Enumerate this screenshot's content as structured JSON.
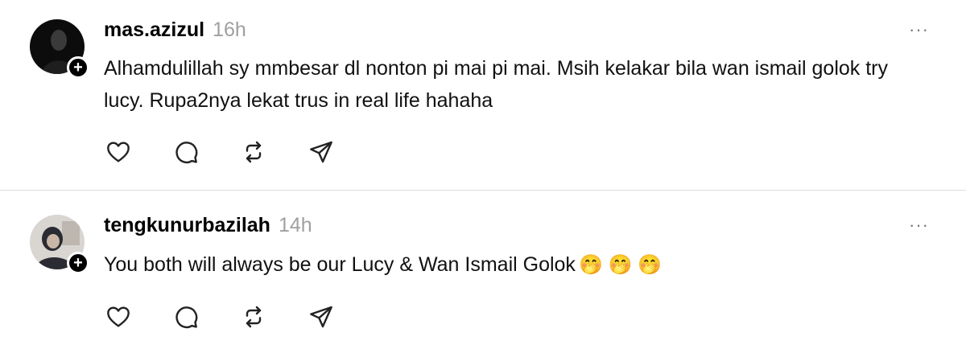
{
  "comments": [
    {
      "username": "mas.azizul",
      "time": "16h",
      "more": "···",
      "text": "Alhamdulillah sy mmbesar dl nonton pi mai pi mai. Msih kelakar bila wan ismail golok try lucy. Rupa2nya lekat trus in real life hahaha",
      "emoji": "",
      "follow_badge": "+"
    },
    {
      "username": "tengkunurbazilah",
      "time": "14h",
      "more": "···",
      "text": "You both will always be our Lucy & Wan Ismail Golok",
      "emoji": "🤭 🤭 🤭",
      "follow_badge": "+"
    }
  ],
  "icons": [
    "heart-icon",
    "comment-icon",
    "repost-icon",
    "share-icon"
  ],
  "colors": {
    "time": "#a0a0a0",
    "divider": "#dcdcdc",
    "text": "#111111"
  }
}
